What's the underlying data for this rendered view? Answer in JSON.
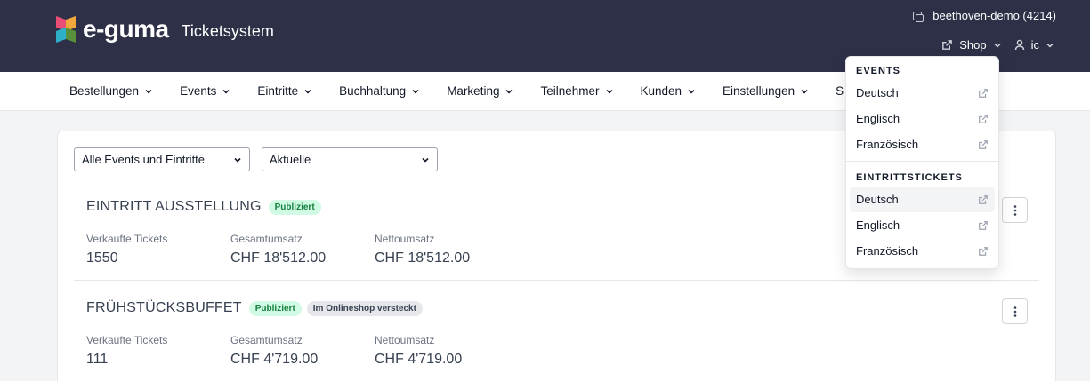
{
  "header": {
    "brand": "e-guma",
    "subtitle": "Ticketsystem",
    "tenant": "beethoven-demo (4214)",
    "shop_label": "Shop",
    "user_label": "ic"
  },
  "nav": {
    "items": [
      {
        "label": "Bestellungen"
      },
      {
        "label": "Events"
      },
      {
        "label": "Eintritte"
      },
      {
        "label": "Buchhaltung"
      },
      {
        "label": "Marketing"
      },
      {
        "label": "Teilnehmer"
      },
      {
        "label": "Kunden"
      },
      {
        "label": "Einstellungen"
      },
      {
        "label": "S"
      }
    ]
  },
  "filters": {
    "scope": "Alle Events und Eintritte",
    "time": "Aktuelle"
  },
  "events": [
    {
      "title": "EINTRITT AUSSTELLUNG",
      "badges": [
        "Publiziert"
      ],
      "stats": [
        {
          "label": "Verkaufte Tickets",
          "value": "1550"
        },
        {
          "label": "Gesamtumsatz",
          "value": "CHF 18'512.00"
        },
        {
          "label": "Nettoumsatz",
          "value": "CHF 18'512.00"
        }
      ]
    },
    {
      "title": "FRÜHSTÜCKSBUFFET",
      "badges": [
        "Publiziert",
        "Im Onlineshop versteckt"
      ],
      "stats": [
        {
          "label": "Verkaufte Tickets",
          "value": "111"
        },
        {
          "label": "Gesamtumsatz",
          "value": "CHF 4'719.00"
        },
        {
          "label": "Nettoumsatz",
          "value": "CHF 4'719.00"
        }
      ]
    }
  ],
  "shop_menu": {
    "sections": [
      {
        "heading": "EVENTS",
        "items": [
          "Deutsch",
          "Englisch",
          "Französisch"
        ]
      },
      {
        "heading": "EINTRITTSTICKETS",
        "items": [
          "Deutsch",
          "Englisch",
          "Französisch"
        ]
      }
    ]
  },
  "colors": {
    "topbar": "#2d3047",
    "badge_green_bg": "#d1fae5",
    "badge_green_text": "#15803d"
  }
}
